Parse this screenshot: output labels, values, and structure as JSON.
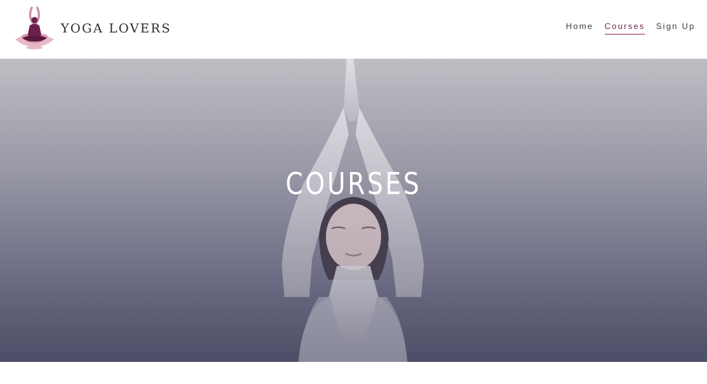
{
  "brand": {
    "name": "YOGA LOVERS",
    "logo_icon": "meditating-figure-lotus-icon",
    "colors": {
      "primary": "#6b1f4a",
      "secondary": "#c98ea6"
    }
  },
  "nav": {
    "items": [
      {
        "label": "Home",
        "active": false
      },
      {
        "label": "Courses",
        "active": true
      },
      {
        "label": "Sign Up",
        "active": false
      }
    ],
    "active_color": "#6b1f4a"
  },
  "hero": {
    "title": "COURSES",
    "background_description_icon": "yoga-woman-raised-hands-photo"
  }
}
